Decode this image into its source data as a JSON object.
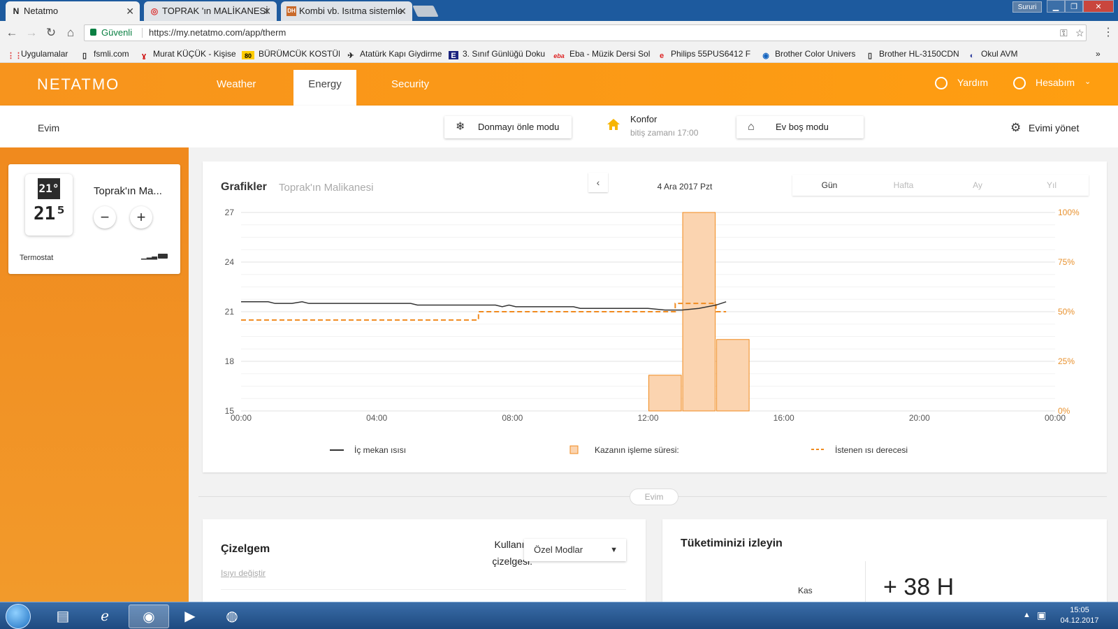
{
  "browser": {
    "tabs": [
      {
        "title": "Netatmo",
        "icon": "N"
      },
      {
        "title": "TOPRAK 'ın MALİKANESİ",
        "icon": "◎"
      },
      {
        "title": "Kombi vb. Isıtma sistemle",
        "icon": "DH"
      }
    ],
    "user_badge": "Sururi",
    "secure_label": "Güvenli",
    "url": "https://my.netatmo.com/app/therm",
    "bookmarks": [
      {
        "label": "Uygulamalar",
        "icon": "⋮⋮"
      },
      {
        "label": "fsmli.com",
        "icon": "▯"
      },
      {
        "label": "Murat KÜÇÜK - Kişise",
        "icon": "ɣ"
      },
      {
        "label": "BÜRÜMCÜK KOSTÜM",
        "icon": "80"
      },
      {
        "label": "Atatürk Kapı Giydirme",
        "icon": "✈"
      },
      {
        "label": "3. Sınıf Günlüğü Doku",
        "icon": "E"
      },
      {
        "label": "Eba - Müzik Dersi Sol",
        "icon": "eba"
      },
      {
        "label": "Philips 55PUS6412 F",
        "icon": "e"
      },
      {
        "label": "Brother Color Univers",
        "icon": "◉"
      },
      {
        "label": "Brother HL-3150CDN",
        "icon": "▯"
      },
      {
        "label": "Okul AVM",
        "icon": "◐"
      }
    ],
    "more_bookmarks": "»"
  },
  "header": {
    "logo": "NETATMO",
    "nav": [
      "Weather",
      "Energy",
      "Security"
    ],
    "help": "Yardım",
    "account": "Hesabım"
  },
  "subheader": {
    "home": "Evim",
    "frost_mode": "Donmayı önle modu",
    "comfort_title": "Konfor",
    "comfort_sub": "bitiş zamanı 17:00",
    "away_mode": "Ev boş modu",
    "manage": "Evimi yönet"
  },
  "thermostat": {
    "current_temp": "21°",
    "set_temp": "21⁵",
    "name": "Toprak'ın Ma...",
    "label": "Termostat",
    "minus": "−",
    "plus": "+"
  },
  "graph": {
    "title": "Grafikler",
    "subtitle": "Toprak'ın Malikanesi",
    "prev": "‹",
    "date": "4 Ara 2017 Pzt",
    "ranges": [
      "Gün",
      "Hafta",
      "Ay",
      "Yıl"
    ],
    "active_range": "Gün",
    "legend": {
      "indoor": "İç mekan ısısı",
      "boiler": "Kazanın işleme süresi:",
      "setpoint": "İstenen ısı derecesi"
    }
  },
  "chart_data": {
    "type": "line",
    "x_ticks": [
      "00:00",
      "04:00",
      "08:00",
      "12:00",
      "16:00",
      "20:00",
      "00:00"
    ],
    "y_ticks": [
      15,
      18,
      21,
      24,
      27
    ],
    "y2_ticks": [
      "0%",
      "25%",
      "50%",
      "75%",
      "100%"
    ],
    "ylim": [
      15,
      27
    ],
    "y2lim": [
      0,
      100
    ],
    "xlim_hours": [
      0,
      24
    ],
    "colors": {
      "indoor": "#333333",
      "setpoint": "#f08a1e",
      "boiler_fill": "#fbd4b0",
      "boiler_stroke": "#f08a1e",
      "y2": "#e8912e"
    },
    "series": [
      {
        "name": "İç mekan ısısı",
        "x_hours": [
          0,
          0.8,
          1.0,
          1.5,
          1.8,
          2.0,
          4.0,
          5.0,
          5.2,
          7.5,
          7.7,
          7.9,
          8.1,
          8.5,
          9.0,
          9.8,
          10.0,
          12.0,
          12.5,
          13.0,
          13.5,
          14.0,
          14.3
        ],
        "values": [
          21.6,
          21.6,
          21.5,
          21.5,
          21.6,
          21.5,
          21.5,
          21.5,
          21.4,
          21.4,
          21.3,
          21.4,
          21.3,
          21.3,
          21.3,
          21.3,
          21.2,
          21.2,
          21.1,
          21.1,
          21.2,
          21.4,
          21.6
        ]
      },
      {
        "name": "İstenen ısı derecesi",
        "x_hours": [
          0,
          7.0,
          7.0,
          12.8,
          12.8,
          14.0,
          14.0,
          14.3
        ],
        "values": [
          20.5,
          20.5,
          21.0,
          21.0,
          21.5,
          21.5,
          21.0,
          21.0
        ]
      },
      {
        "name": "Kazanın işleme süresi:",
        "type": "bar",
        "bins_hours": [
          [
            12,
            13
          ],
          [
            13,
            14
          ],
          [
            14,
            15
          ]
        ],
        "values_percent": [
          18,
          100,
          36
        ]
      }
    ]
  },
  "divider_label": "Evim",
  "schedule": {
    "title": "Çizelgem",
    "link": "Isıyı değiştir",
    "label": "Kullanım çizelgesi:",
    "selected": "Özel Modlar"
  },
  "consumption": {
    "title": "Tüketiminizi izleyin",
    "month": "Kas",
    "value": "+ 38 H"
  },
  "taskbar": {
    "time": "15:05",
    "date": "04.12.2017"
  }
}
